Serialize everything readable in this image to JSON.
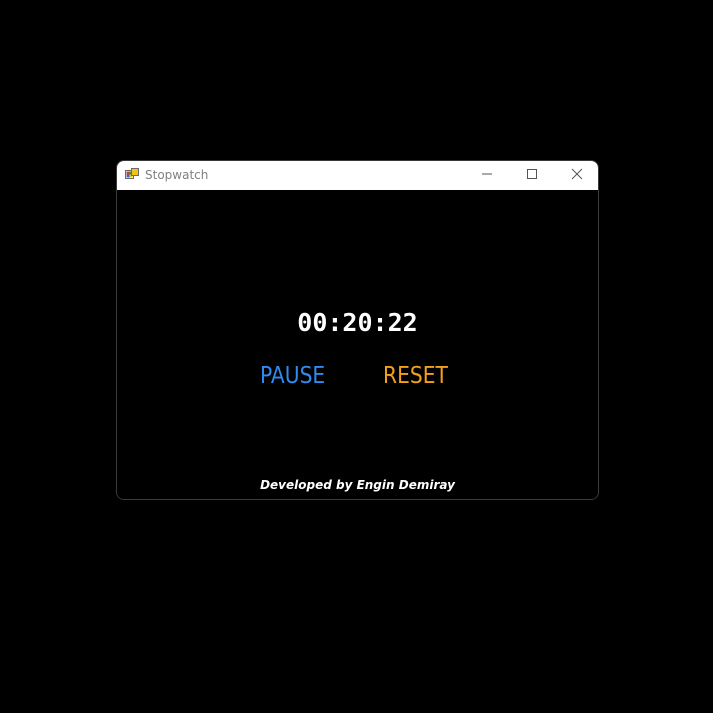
{
  "window": {
    "title": "Stopwatch",
    "icon": "app-window-icon",
    "controls": {
      "minimize_icon": "minimize-icon",
      "maximize_icon": "maximize-icon",
      "close_icon": "close-icon"
    }
  },
  "stopwatch": {
    "time": "00:20:22",
    "pause_label": "PAUSE",
    "reset_label": "RESET",
    "footer": "Developed by Engin Demiray"
  },
  "colors": {
    "background": "#000000",
    "pause": "#2e8bf0",
    "reset": "#f5a01a",
    "time": "#ffffff"
  }
}
